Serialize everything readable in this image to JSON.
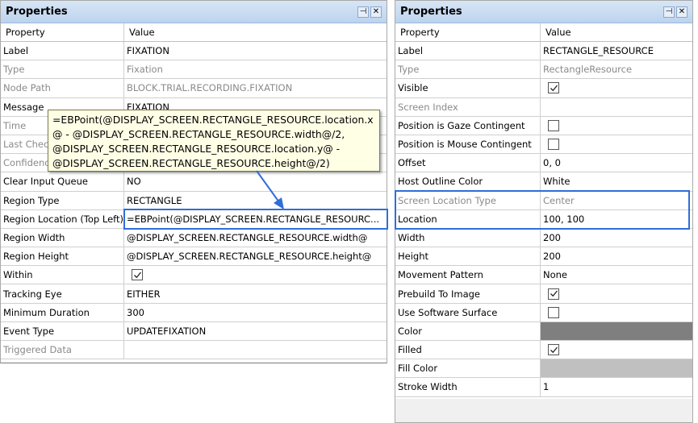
{
  "left_panel": {
    "title": "Properties",
    "header": {
      "property": "Property",
      "value": "Value"
    },
    "rows": [
      {
        "label": "Label",
        "value": "FIXATION"
      },
      {
        "label": "Type",
        "value": "Fixation"
      },
      {
        "label": "Node Path",
        "value": "BLOCK.TRIAL.RECORDING.FIXATION"
      },
      {
        "label": "Message",
        "value": "FIXATION"
      },
      {
        "label": "Time",
        "value": ""
      },
      {
        "label": "Last Check",
        "value": ""
      },
      {
        "label": "Confidence",
        "value": ""
      },
      {
        "label": "Clear Input Queue",
        "value": "NO"
      },
      {
        "label": "Region Type",
        "value": "RECTANGLE"
      },
      {
        "label": "Region Location (Top Left)",
        "value": "=EBPoint(@DISPLAY_SCREEN.RECTANGLE_RESOURC..."
      },
      {
        "label": "Region Width",
        "value": "@DISPLAY_SCREEN.RECTANGLE_RESOURCE.width@"
      },
      {
        "label": "Region Height",
        "value": "@DISPLAY_SCREEN.RECTANGLE_RESOURCE.height@"
      },
      {
        "label": "Within",
        "value": ""
      },
      {
        "label": "Tracking Eye",
        "value": "EITHER"
      },
      {
        "label": "Minimum Duration",
        "value": "300"
      },
      {
        "label": "Event Type",
        "value": "UPDATEFIXATION"
      },
      {
        "label": "Triggered Data",
        "value": ""
      }
    ],
    "tooltip": [
      "=EBPoint(@DISPLAY_SCREEN.RECTANGLE_RESOURCE.location.x",
      "@ - @DISPLAY_SCREEN.RECTANGLE_RESOURCE.width@/2,",
      "@DISPLAY_SCREEN.RECTANGLE_RESOURCE.location.y@ -",
      "@DISPLAY_SCREEN.RECTANGLE_RESOURCE.height@/2)"
    ]
  },
  "right_panel": {
    "title": "Properties",
    "header": {
      "property": "Property",
      "value": "Value"
    },
    "rows": [
      {
        "label": "Label",
        "value": "RECTANGLE_RESOURCE"
      },
      {
        "label": "Type",
        "value": "RectangleResource"
      },
      {
        "label": "Visible",
        "value": ""
      },
      {
        "label": "Screen Index",
        "value": ""
      },
      {
        "label": "Position is Gaze Contingent",
        "value": ""
      },
      {
        "label": "Position is Mouse Contingent",
        "value": ""
      },
      {
        "label": "Offset",
        "value": "0, 0"
      },
      {
        "label": "Host Outline Color",
        "value": "White"
      },
      {
        "label": "Screen Location Type",
        "value": "Center"
      },
      {
        "label": "Location",
        "value": "100, 100"
      },
      {
        "label": "Width",
        "value": "200"
      },
      {
        "label": "Height",
        "value": "200"
      },
      {
        "label": "Movement Pattern",
        "value": "None"
      },
      {
        "label": "Prebuild To Image",
        "value": ""
      },
      {
        "label": "Use Software Surface",
        "value": ""
      },
      {
        "label": "Color",
        "value": ""
      },
      {
        "label": "Filled",
        "value": ""
      },
      {
        "label": "Fill Color",
        "value": ""
      },
      {
        "label": "Stroke Width",
        "value": "1"
      }
    ],
    "checkboxes": {
      "visible": true,
      "gaze_contingent": false,
      "mouse_contingent": false,
      "prebuild_to_image": true,
      "use_software_surface": false,
      "filled": true
    }
  },
  "colors": {
    "highlight": "#2f6ed8",
    "color_swatch": "#7f7f7f",
    "fill_color_swatch": "#c0c0c0",
    "tooltip_bg": "#ffffe6"
  },
  "icons": {
    "pin": "pin-icon",
    "close": "close-icon",
    "check": "checkmark-icon",
    "arrow": "arrow-icon"
  }
}
